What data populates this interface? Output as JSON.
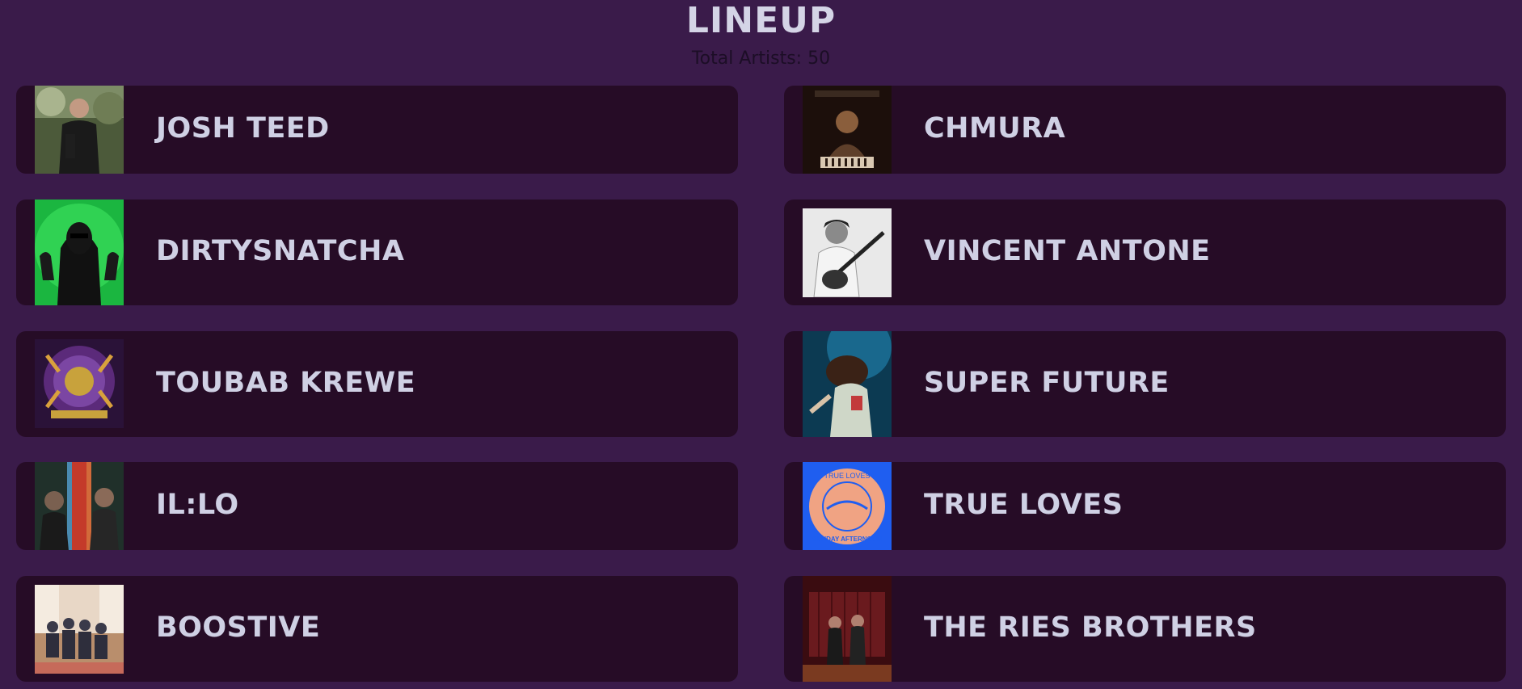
{
  "header": {
    "title": "LINEUP",
    "subtitle": "Total Artists: 50"
  },
  "artists": [
    {
      "name": "JOSH TEED",
      "photo_icon": "artist-photo-josh-teed"
    },
    {
      "name": "CHMURA",
      "photo_icon": "artist-photo-chmura"
    },
    {
      "name": "DIRTYSNATCHA",
      "photo_icon": "artist-photo-dirtysnatcha"
    },
    {
      "name": "VINCENT ANTONE",
      "photo_icon": "artist-photo-vincent-antone"
    },
    {
      "name": "TOUBAB KREWE",
      "photo_icon": "artist-photo-toubab-krewe"
    },
    {
      "name": "SUPER FUTURE",
      "photo_icon": "artist-photo-super-future"
    },
    {
      "name": "IL:LO",
      "photo_icon": "artist-photo-il-lo"
    },
    {
      "name": "TRUE LOVES",
      "photo_icon": "artist-photo-true-loves"
    },
    {
      "name": "BOOSTIVE",
      "photo_icon": "artist-photo-boostive"
    },
    {
      "name": "THE RIES BROTHERS",
      "photo_icon": "artist-photo-the-ries-brothers"
    }
  ],
  "true_loves_badge": {
    "top_text": "TRUE LOVES",
    "bottom_text": "SUNDAY AFTERNOON"
  },
  "colors": {
    "background": "#3a1b4a",
    "card": "#260c26",
    "text": "#cfd0e4"
  }
}
